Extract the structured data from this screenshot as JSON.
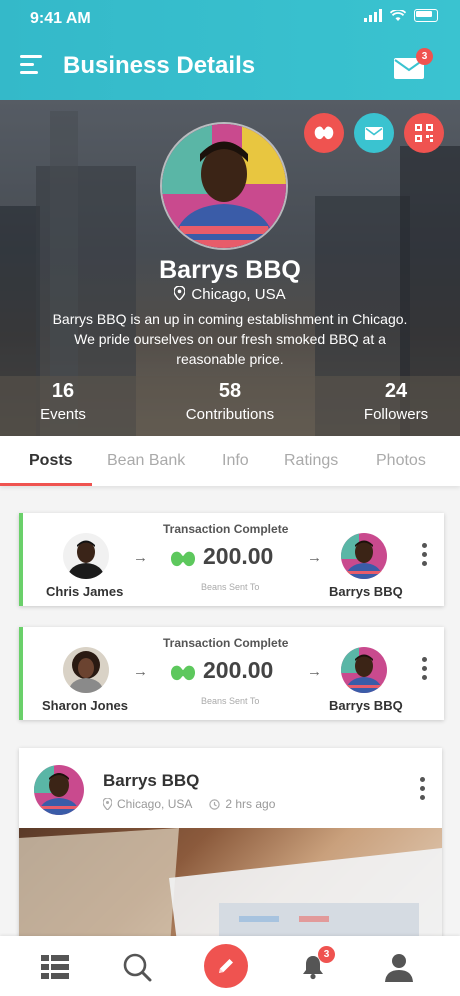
{
  "status_bar": {
    "time": "9:41 AM"
  },
  "header": {
    "title": "Business Details",
    "mail_badge": "3"
  },
  "profile": {
    "name": "Barrys BBQ",
    "location": "Chicago, USA",
    "description": "Barrys BBQ is an up in coming establishment in Chicago. We pride ourselves on our fresh smoked BBQ at a reasonable price.",
    "stats": [
      {
        "value": "16",
        "label": "Events"
      },
      {
        "value": "58",
        "label": "Contributions"
      },
      {
        "value": "24",
        "label": "Followers"
      }
    ]
  },
  "tabs": [
    "Posts",
    "Bean Bank",
    "Info",
    "Ratings",
    "Photos"
  ],
  "active_tab": "Posts",
  "transactions": [
    {
      "status": "Transaction Complete",
      "from": "Chris James",
      "amount": "200.00",
      "subtext": "Beans Sent To",
      "to": "Barrys BBQ"
    },
    {
      "status": "Transaction Complete",
      "from": "Sharon Jones",
      "amount": "200.00",
      "subtext": "Beans Sent To",
      "to": "Barrys BBQ"
    }
  ],
  "post": {
    "author": "Barrys BBQ",
    "location": "Chicago, USA",
    "time": "2 hrs ago"
  },
  "bottom_nav": {
    "notifications_badge": "3"
  },
  "colors": {
    "header": "#3ac3d0",
    "accent": "#ef5350",
    "success": "#6ad06a",
    "teal_button": "#3ac3d0"
  }
}
